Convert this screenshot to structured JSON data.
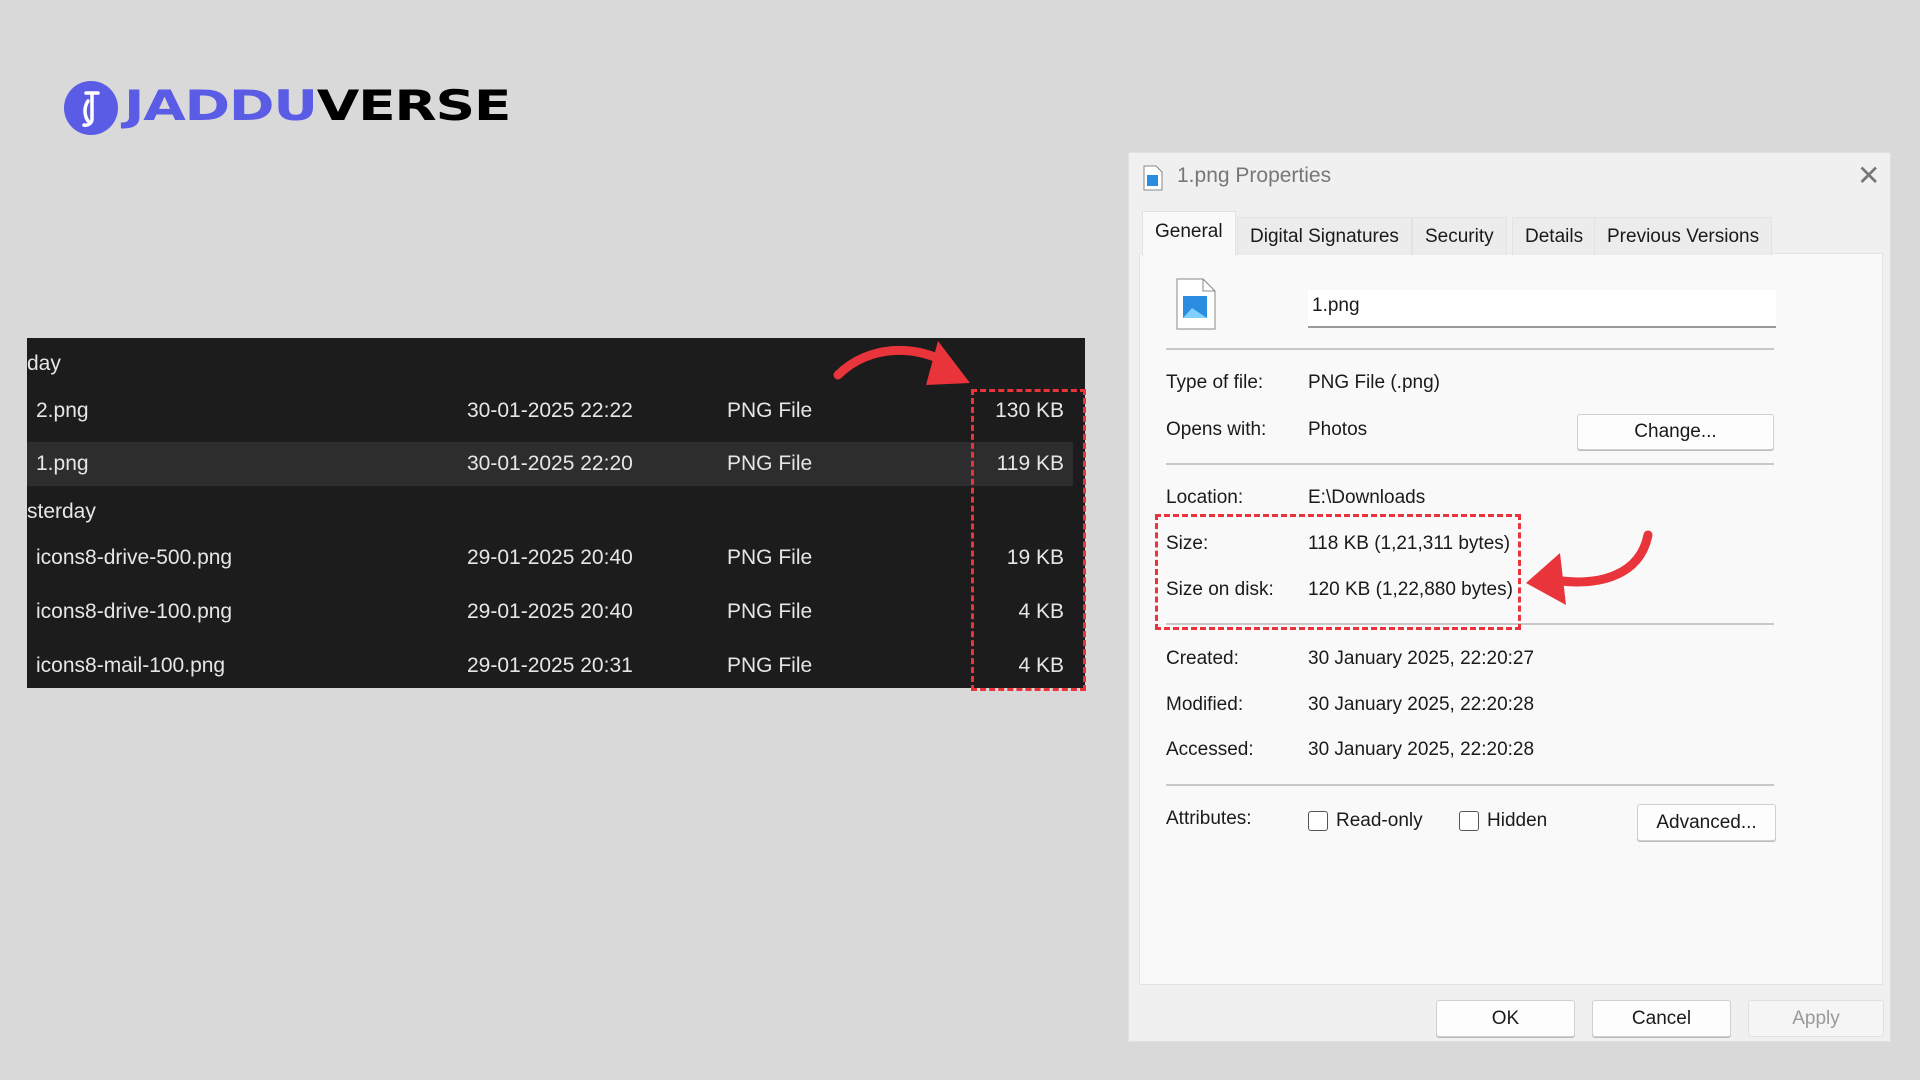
{
  "logo": {
    "part1": "JADDU",
    "part2": "VERSE",
    "brand_color": "#5b5ce6"
  },
  "explorer": {
    "groups": [
      {
        "label": "day",
        "rows": [
          {
            "name": "2.png",
            "date": "30-01-2025 22:22",
            "type": "PNG File",
            "size": "130 KB"
          },
          {
            "name": "1.png",
            "date": "30-01-2025 22:20",
            "type": "PNG File",
            "size": "119 KB",
            "selected": true
          }
        ]
      },
      {
        "label": "sterday",
        "rows": [
          {
            "name": "icons8-drive-500.png",
            "date": "29-01-2025 20:40",
            "type": "PNG File",
            "size": "19 KB"
          },
          {
            "name": "icons8-drive-100.png",
            "date": "29-01-2025 20:40",
            "type": "PNG File",
            "size": "4 KB"
          },
          {
            "name": "icons8-mail-100.png",
            "date": "29-01-2025 20:31",
            "type": "PNG File",
            "size": "4 KB"
          }
        ]
      }
    ]
  },
  "dialog": {
    "title": "1.png Properties",
    "tabs": [
      "General",
      "Digital Signatures",
      "Security",
      "Details",
      "Previous Versions"
    ],
    "active_tab": "General",
    "file_name": "1.png",
    "fields": {
      "type_label": "Type of file:",
      "type_value": "PNG File (.png)",
      "opens_label": "Opens with:",
      "opens_value": "Photos",
      "change_button": "Change...",
      "location_label": "Location:",
      "location_value": "E:\\Downloads",
      "size_label": "Size:",
      "size_value": "118 KB (1,21,311 bytes)",
      "disk_label": "Size on disk:",
      "disk_value": "120 KB (1,22,880 bytes)",
      "created_label": "Created:",
      "created_value": "30 January 2025, 22:20:27",
      "modified_label": "Modified:",
      "modified_value": "30 January 2025, 22:20:28",
      "accessed_label": "Accessed:",
      "accessed_value": "30 January 2025, 22:20:28",
      "attributes_label": "Attributes:",
      "readonly_label": "Read-only",
      "hidden_label": "Hidden",
      "advanced_button": "Advanced...",
      "readonly_checked": false,
      "hidden_checked": false
    },
    "buttons": {
      "ok": "OK",
      "cancel": "Cancel",
      "apply": "Apply"
    }
  },
  "annotation_color": "#e8343a"
}
